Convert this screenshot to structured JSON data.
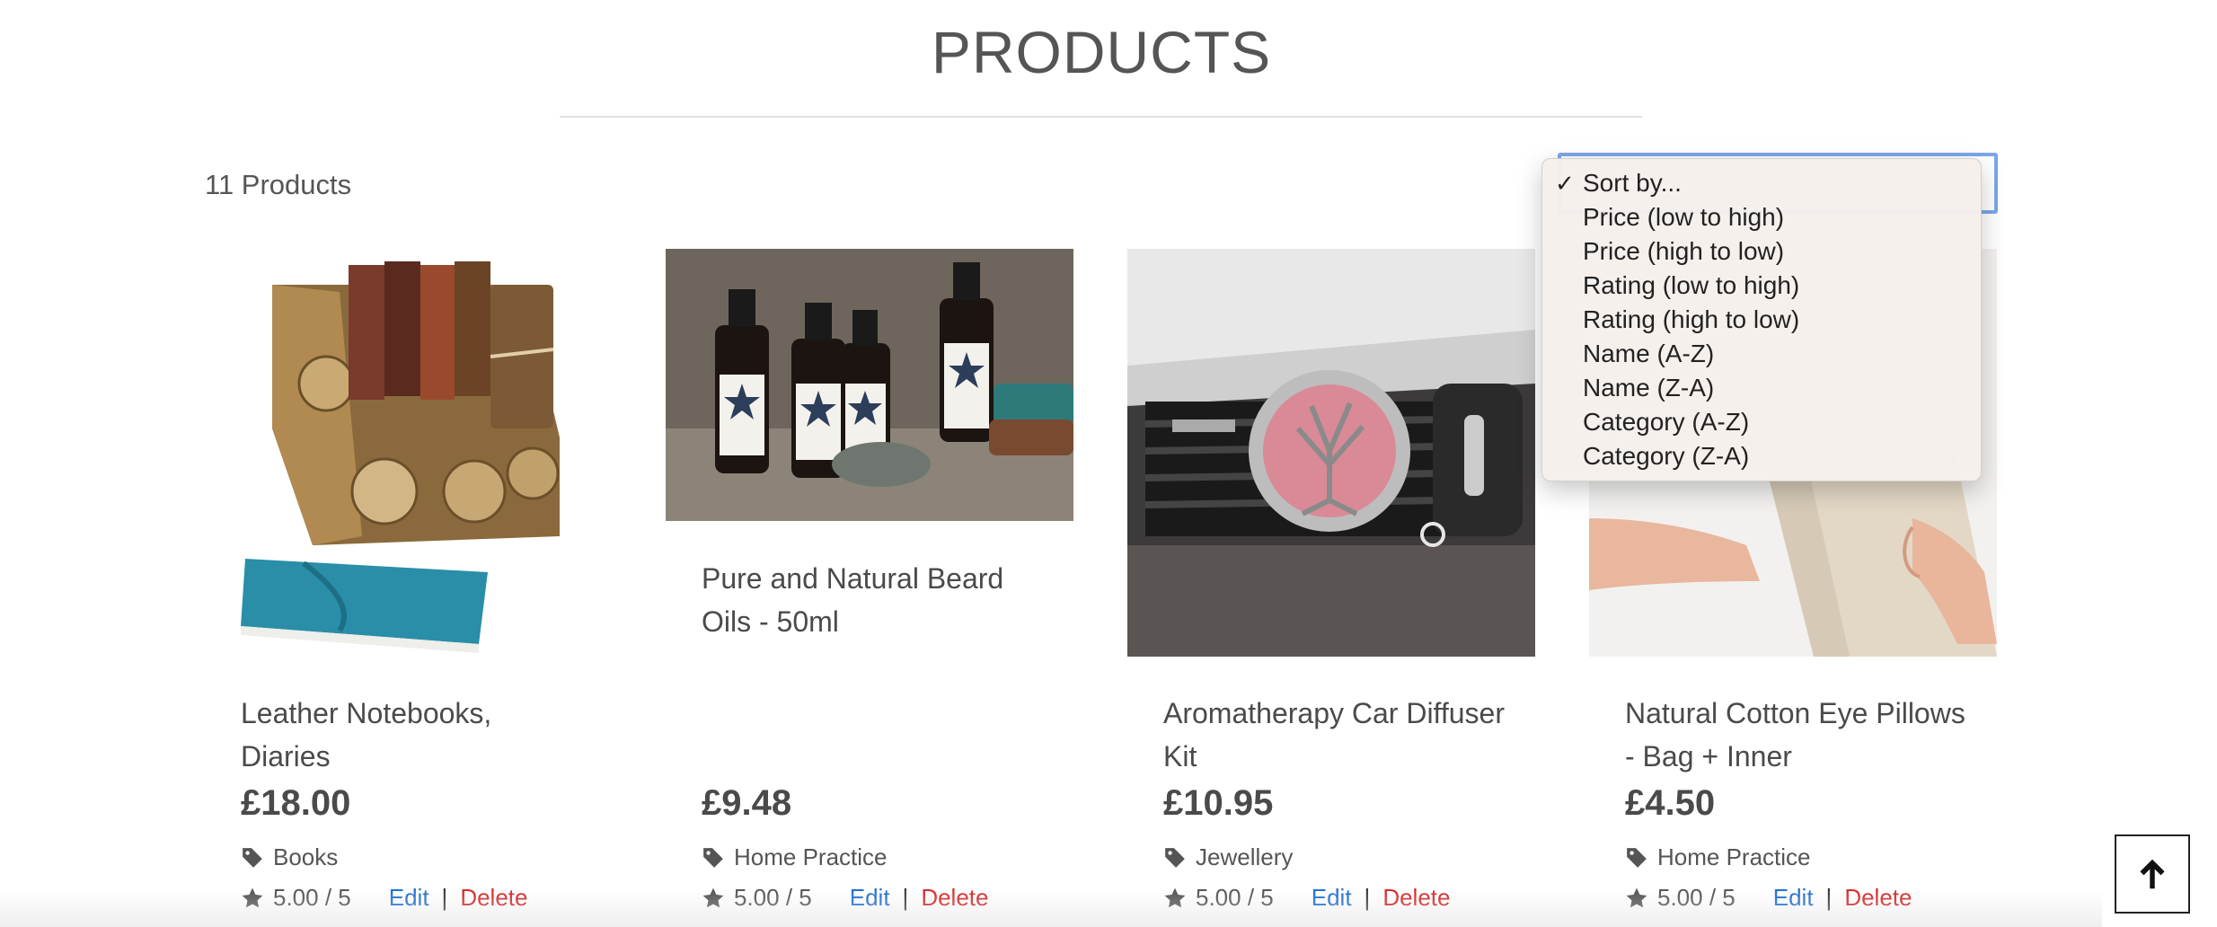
{
  "page": {
    "title": "PRODUCTS",
    "product_count": "11 Products"
  },
  "sort": {
    "options": [
      {
        "label": "Sort by...",
        "selected": true
      },
      {
        "label": "Price (low to high)",
        "selected": false
      },
      {
        "label": "Price (high to low)",
        "selected": false
      },
      {
        "label": "Rating (low to high)",
        "selected": false
      },
      {
        "label": "Rating (high to low)",
        "selected": false
      },
      {
        "label": "Name (A-Z)",
        "selected": false
      },
      {
        "label": "Name (Z-A)",
        "selected": false
      },
      {
        "label": "Category (A-Z)",
        "selected": false
      },
      {
        "label": "Category (Z-A)",
        "selected": false
      }
    ],
    "check_mark": "✓"
  },
  "products": [
    {
      "name": "Leather Notebooks, Diaries",
      "price": "£18.00",
      "category": "Books",
      "rating": "5.00 / 5",
      "image": "leather-notebooks-image"
    },
    {
      "name": "Pure and Natural Beard Oils - 50ml",
      "price": "£9.48",
      "category": "Home Practice",
      "rating": "5.00 / 5",
      "image": "beard-oil-bottles-image"
    },
    {
      "name": "Aromatherapy Car Diffuser Kit",
      "price": "£10.95",
      "category": "Jewellery",
      "rating": "5.00 / 5",
      "image": "car-diffuser-image"
    },
    {
      "name": "Natural Cotton Eye Pillows - Bag + Inner",
      "price": "£4.50",
      "category": "Home Practice",
      "rating": "5.00 / 5",
      "image": "eye-pillow-image"
    }
  ],
  "actions": {
    "edit": "Edit",
    "separator": "|",
    "delete": "Delete"
  },
  "icons": {
    "tag": "tag-icon",
    "star": "star-icon",
    "scroll_top": "arrow-up-icon"
  },
  "colors": {
    "edit_link": "#1f6fd1",
    "delete_link": "#d42a2a",
    "select_focus": "#7aa7e8"
  }
}
